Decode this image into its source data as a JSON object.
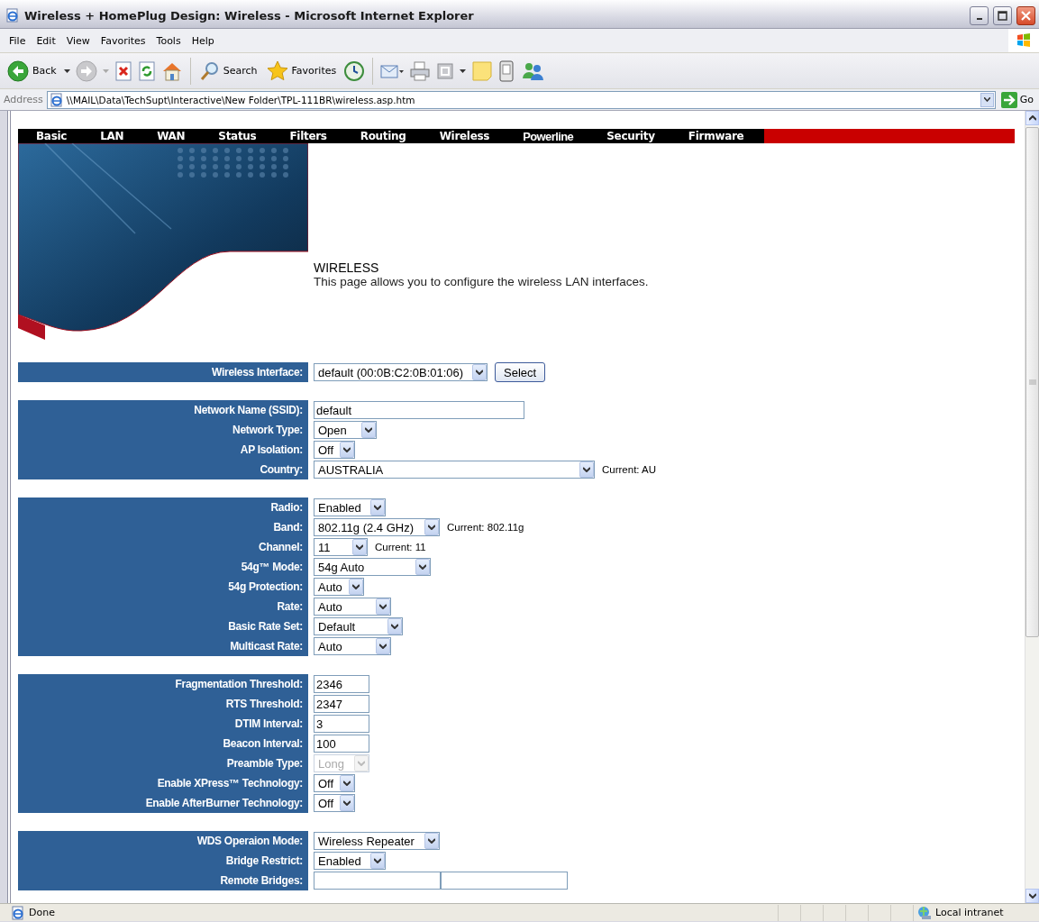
{
  "window": {
    "title": "Wireless + HomePlug Design: Wireless - Microsoft Internet Explorer"
  },
  "menu": [
    "File",
    "Edit",
    "View",
    "Favorites",
    "Tools",
    "Help"
  ],
  "toolbar": {
    "back": "Back",
    "search": "Search",
    "favorites": "Favorites"
  },
  "address": {
    "label": "Address",
    "url": "\\\\MAIL\\Data\\TechSupt\\Interactive\\New Folder\\TPL-111BR\\wireless.asp.htm",
    "go": "Go"
  },
  "nav": [
    "Basic",
    "LAN",
    "WAN",
    "Status",
    "Filters",
    "Routing",
    "Wireless",
    "Powerline",
    "Security",
    "Firmware"
  ],
  "page": {
    "title": "WIRELESS",
    "description": "This page allows you to configure the wireless LAN interfaces."
  },
  "sections": [
    {
      "rows": [
        {
          "label": "Wireless Interface:",
          "kind": "select",
          "value": "default (00:0B:C2:0B:01:06)",
          "disabled": false,
          "button": "Select"
        }
      ]
    },
    {
      "rows": [
        {
          "label": "Network Name (SSID):",
          "kind": "text",
          "value": "default",
          "disabled": false
        },
        {
          "label": "Network Type:",
          "kind": "select",
          "value": "Open",
          "disabled": false
        },
        {
          "label": "AP Isolation:",
          "kind": "select",
          "value": "Off",
          "disabled": false
        },
        {
          "label": "Country:",
          "kind": "select",
          "value": "AUSTRALIA",
          "disabled": false,
          "note": "Current: AU"
        }
      ]
    },
    {
      "rows": [
        {
          "label": "Radio:",
          "kind": "select",
          "value": "Enabled",
          "disabled": false
        },
        {
          "label": "Band:",
          "kind": "select",
          "value": "802.11g (2.4 GHz)",
          "disabled": false,
          "note": "Current: 802.11g"
        },
        {
          "label": "Channel:",
          "kind": "select",
          "value": "11",
          "disabled": false,
          "note": "Current: 11"
        },
        {
          "label": "54g™ Mode:",
          "kind": "select",
          "value": "54g Auto",
          "disabled": false
        },
        {
          "label": "54g Protection:",
          "kind": "select",
          "value": "Auto",
          "disabled": false
        },
        {
          "label": "Rate:",
          "kind": "select",
          "value": "Auto",
          "disabled": false
        },
        {
          "label": "Basic Rate Set:",
          "kind": "select",
          "value": "Default",
          "disabled": false
        },
        {
          "label": "Multicast Rate:",
          "kind": "select",
          "value": "Auto",
          "disabled": false
        }
      ]
    },
    {
      "rows": [
        {
          "label": "Fragmentation Threshold:",
          "kind": "text",
          "value": "2346",
          "disabled": false
        },
        {
          "label": "RTS Threshold:",
          "kind": "text",
          "value": "2347",
          "disabled": false
        },
        {
          "label": "DTIM Interval:",
          "kind": "text",
          "value": "3",
          "disabled": false
        },
        {
          "label": "Beacon Interval:",
          "kind": "text",
          "value": "100",
          "disabled": false
        },
        {
          "label": "Preamble Type:",
          "kind": "select",
          "value": "Long",
          "disabled": true
        },
        {
          "label": "Enable XPress™ Technology:",
          "kind": "select",
          "value": "Off",
          "disabled": false
        },
        {
          "label": "Enable AfterBurner Technology:",
          "kind": "select",
          "value": "Off",
          "disabled": false
        }
      ]
    },
    {
      "rows": [
        {
          "label": "WDS Operaion Mode:",
          "kind": "select",
          "value": "Wireless Repeater",
          "disabled": false
        },
        {
          "label": "Bridge Restrict:",
          "kind": "select",
          "value": "Enabled",
          "disabled": false
        },
        {
          "label": "Remote Bridges:",
          "kind": "pair",
          "disabled": false
        }
      ]
    }
  ],
  "status_bar": {
    "text": "Done",
    "zone": "Local intranet"
  }
}
